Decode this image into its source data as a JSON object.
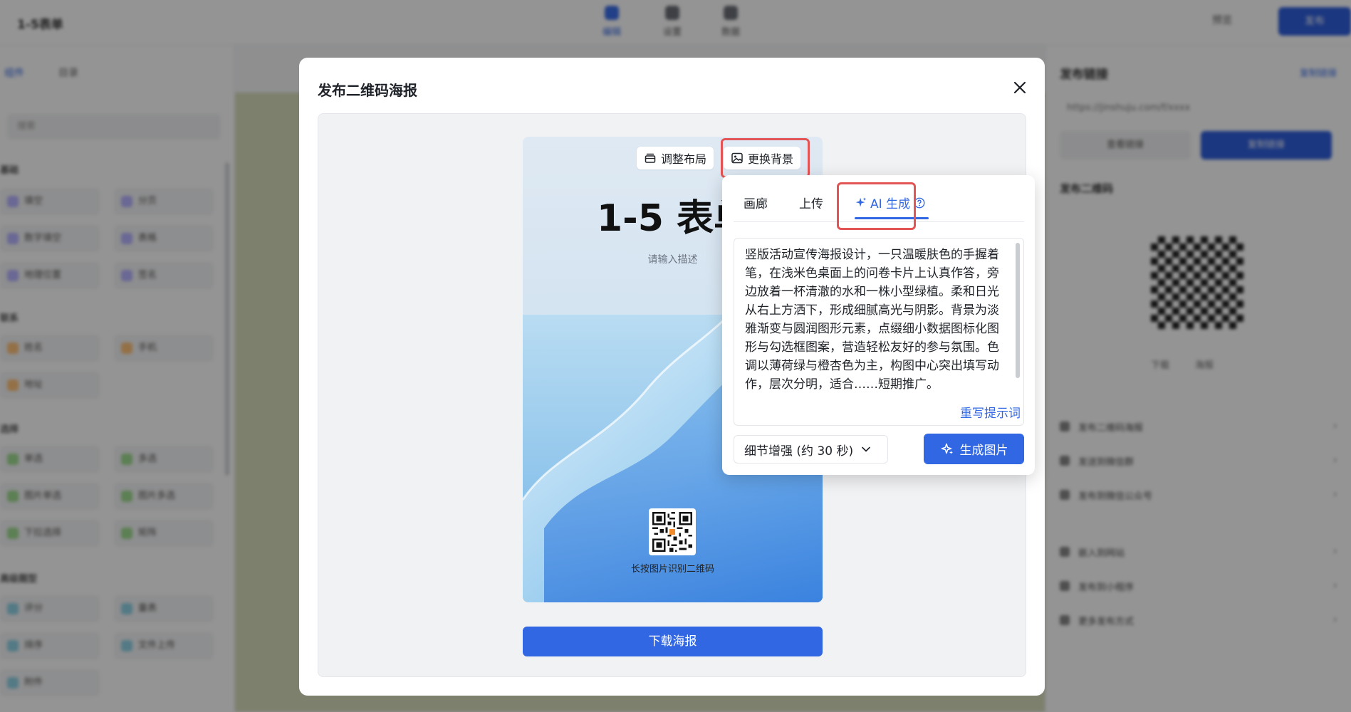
{
  "background_app": {
    "title": "1-5表单",
    "top_tabs": [
      "编辑",
      "设置",
      "数据"
    ],
    "preview_label": "预览",
    "publish_label": "发布",
    "left_tabs": [
      "组件",
      "目录"
    ],
    "search_placeholder": "搜索",
    "groups": [
      "基础",
      "联系",
      "选择",
      "高级题型"
    ],
    "items": [
      "填空",
      "分页",
      "数字填空",
      "表格",
      "地理位置",
      "签名",
      "姓名",
      "手机",
      "地址",
      "单选",
      "多选",
      "图片单选",
      "图片多选",
      "下拉选择",
      "矩阵",
      "评分",
      "量表",
      "排序",
      "文件上传",
      "附件"
    ],
    "right_title": "发布链接",
    "right_link": "复制链接",
    "right_url": "https://jinshuju.com/f/xxxx",
    "right_buttons": [
      "查看链接",
      "复制链接"
    ],
    "right_subtitle": "发布二维码",
    "qr_actions": [
      "下载",
      "海报"
    ],
    "right_rows": [
      "发布二维码海报",
      "发送到微信群",
      "发布到微信公众号",
      "嵌入到网站",
      "发布到小程序",
      "更多发布方式"
    ]
  },
  "modal": {
    "title": "发布二维码海报",
    "layout_chip": "调整布局",
    "background_chip": "更换背景",
    "poster": {
      "title": "1-5 表单",
      "description": "请输入描述",
      "qr_caption": "长按图片识别二维码"
    },
    "download_button": "下载海报"
  },
  "popover": {
    "tabs": {
      "gallery": "画廊",
      "upload": "上传",
      "ai": "AI 生成"
    },
    "prompt_text": "竖版活动宣传海报设计，一只温暖肤色的手握着笔，在浅米色桌面上的问卷卡片上认真作答，旁边放着一杯清澈的水和一株小型绿植。柔和日光从右上方洒下，形成细腻高光与阴影。背景为淡雅渐变与圆润图形元素，点缀细小数据图标化图形与勾选框图案，营造轻松友好的参与氛围。色调以薄荷绿与橙杏色为主，构图中心突出填写动作，层次分明，适合……短期推广。",
    "rewrite_label": "重写提示词",
    "quality_select": "细节增强 (约 30 秒)",
    "generate_button": "生成图片"
  },
  "colors": {
    "accent": "#3267e3",
    "highlight": "#e35454"
  }
}
